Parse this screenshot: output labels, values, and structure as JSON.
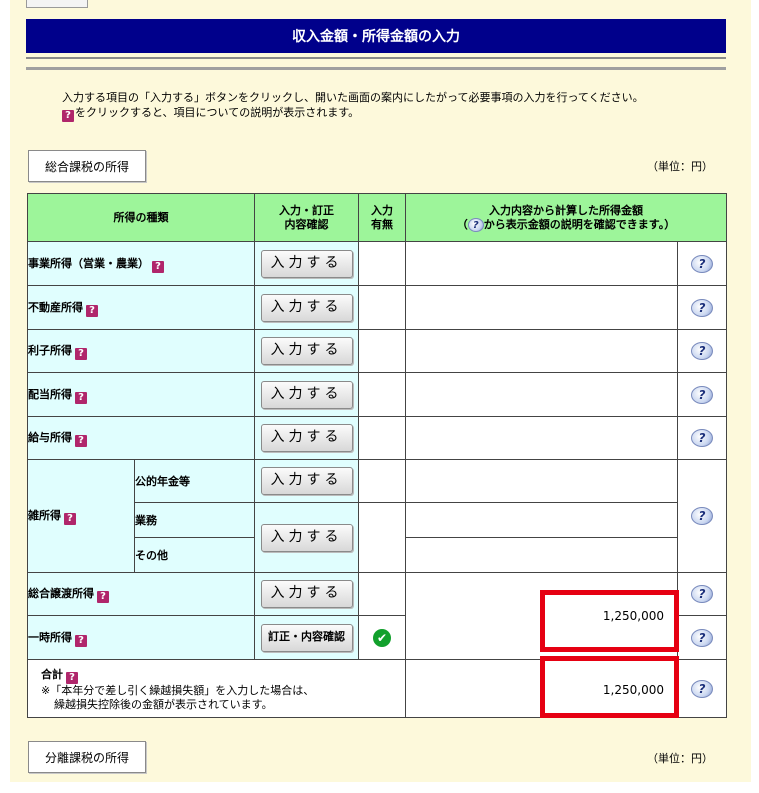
{
  "title": "収入金額・所得金額の入力",
  "intro": {
    "line1": "入力する項目の「入力する」ボタンをクリックし、開いた画面の案内にしたがって必要事項の入力を行ってください。",
    "line2": "をクリックすると、項目についての説明が表示されます。"
  },
  "section1_button": "総合課税の所得",
  "section2_button": "分離課税の所得",
  "unit_label": "（単位：円）",
  "headers": {
    "type": "所得の種類",
    "entry": "入力・訂正\n内容確認",
    "status": "入力\n有無",
    "amount_line1": "入力内容から計算した所得金額",
    "amount_line2_pre": "（",
    "amount_line2_post": "から表示金額の説明を確認できます。）"
  },
  "enter_label": "入力する",
  "confirm_label": "訂正・内容確認",
  "rows": {
    "business": "事業所得（営業・農業）",
    "real_estate": "不動産所得",
    "interest": "利子所得",
    "dividend": "配当所得",
    "salary": "給与所得",
    "misc": "雑所得",
    "misc_pension": "公的年金等",
    "misc_business": "業務",
    "misc_other": "その他",
    "comprehensive_transfer": "総合譲渡所得",
    "occasional": "一時所得"
  },
  "total": {
    "label": "合計",
    "note_line1": "※「本年分で差し引く繰越損失額」を入力した場合は、",
    "note_line2": "繰越損失控除後の金額が表示されています。"
  },
  "amounts": {
    "transfer_occasional": "1,250,000",
    "total": "1,250,000"
  },
  "icons": {
    "question": "?",
    "help": "?",
    "check": "✔"
  },
  "colors": {
    "title_bar": "#00008b",
    "header_bg": "#9df59a",
    "label_bg": "#e0fefe",
    "highlight": "#e60012"
  }
}
